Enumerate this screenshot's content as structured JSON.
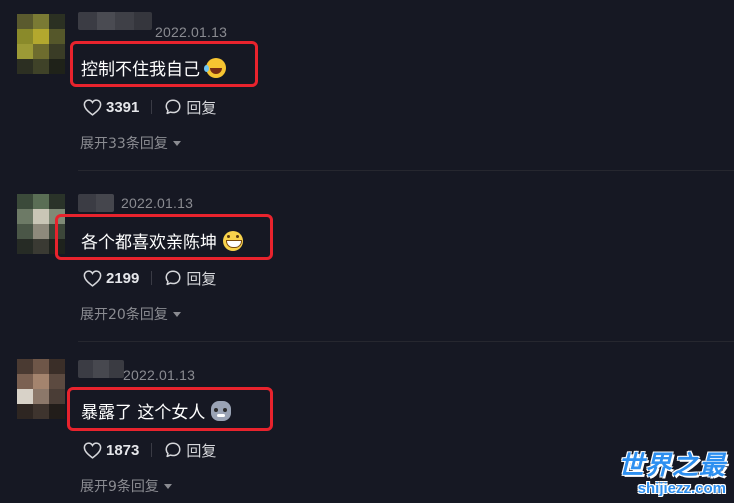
{
  "comments": [
    {
      "date": "2022.01.13",
      "text": "控制不住我自己",
      "emoji": "rolling-laughing-emoji",
      "likes": "3391",
      "reply_label": "回复",
      "expand_label": "展开33条回复"
    },
    {
      "date": "2022.01.13",
      "text": "各个都喜欢亲陈坤",
      "emoji": "grinning-emoji",
      "likes": "2199",
      "reply_label": "回复",
      "expand_label": "展开20条回复"
    },
    {
      "date": "2022.01.13",
      "text": "暴露了 这个女人",
      "emoji": "cat-emoji",
      "likes": "1873",
      "reply_label": "回复",
      "expand_label": "展开9条回复"
    }
  ],
  "watermark": {
    "title": "世界之最",
    "url": "shijiezz.com"
  },
  "colors": {
    "background": "#161823",
    "highlight_box": "#e8232d",
    "muted_text": "#8a8b91",
    "watermark": "#2d8ff0"
  }
}
